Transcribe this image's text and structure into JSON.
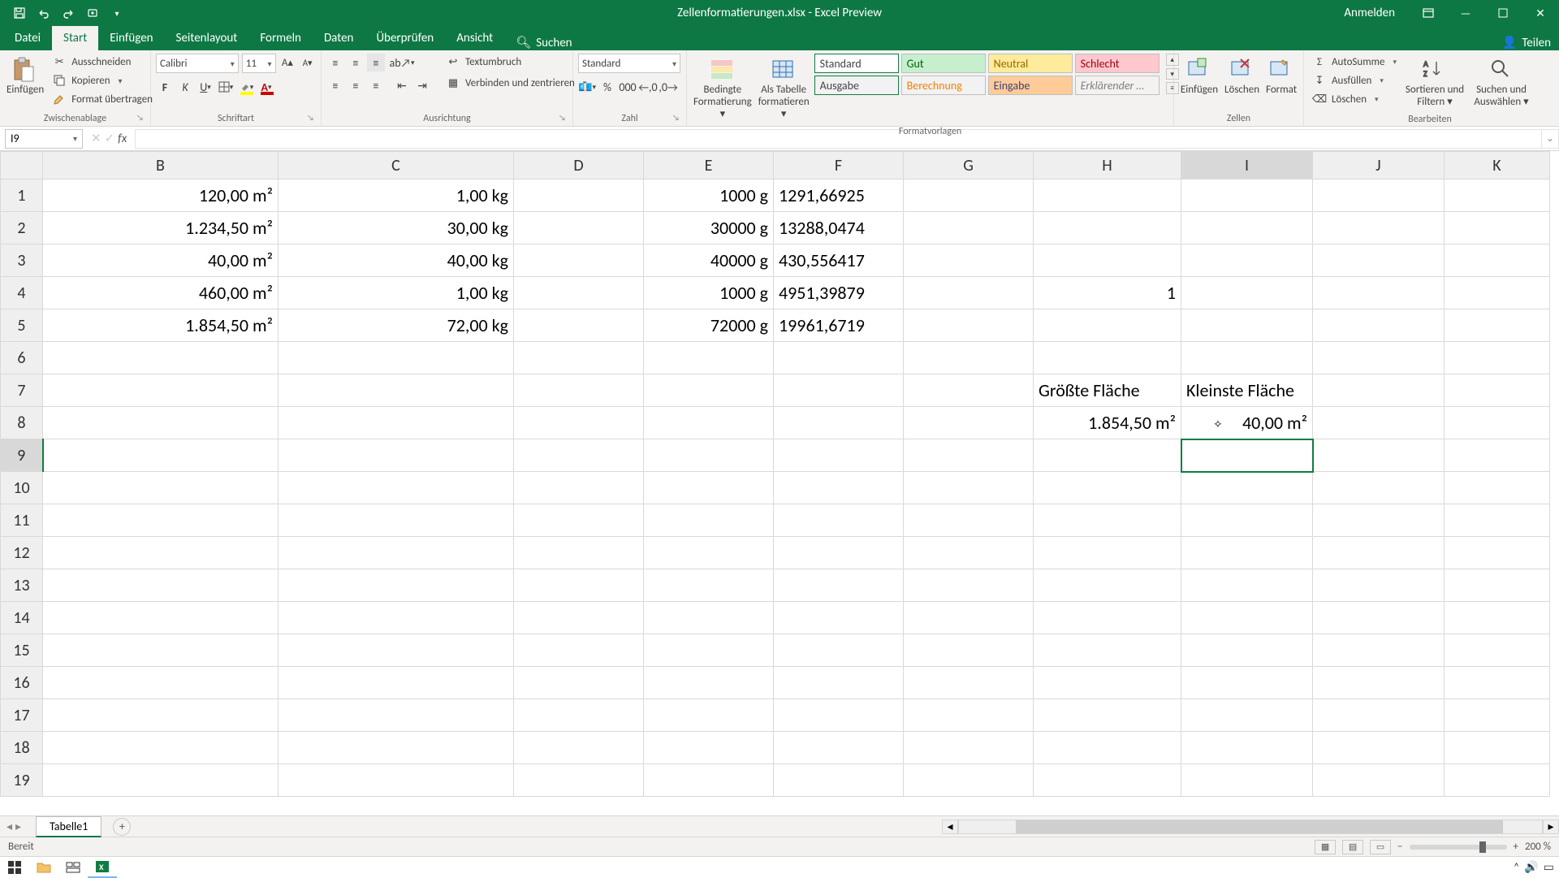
{
  "title_suffix": " - Excel Preview",
  "title_file": "Zellenformatierungen.xlsx",
  "signin": "Anmelden",
  "share": "Teilen",
  "tabs": {
    "file": "Datei",
    "home": "Start",
    "insert": "Einfügen",
    "layout": "Seitenlayout",
    "formulas": "Formeln",
    "data": "Daten",
    "review": "Überprüfen",
    "view": "Ansicht",
    "search": "Suchen"
  },
  "clipboard": {
    "paste": "Einfügen",
    "cut": "Ausschneiden",
    "copy": "Kopieren",
    "format_painter": "Format übertragen",
    "group": "Zwischenablage"
  },
  "font": {
    "name": "Calibri",
    "size": "11",
    "group": "Schriftart"
  },
  "alignment": {
    "wrap": "Textumbruch",
    "merge": "Verbinden und zentrieren",
    "group": "Ausrichtung"
  },
  "number": {
    "format": "Standard",
    "group": "Zahl"
  },
  "styles": {
    "cond": "Bedingte",
    "cond2": "Formatierung ▾",
    "table": "Als Tabelle",
    "table2": "formatieren ▾",
    "s1": "Standard",
    "s2": "Gut",
    "s3": "Neutral",
    "s4": "Schlecht",
    "s5": "Ausgabe",
    "s6": "Berechnung",
    "s7": "Eingabe",
    "s8": "Erklärender …",
    "group": "Formatvorlagen"
  },
  "cells": {
    "insert": "Einfügen",
    "delete": "Löschen",
    "format": "Format",
    "group": "Zellen"
  },
  "editing": {
    "sum": "AutoSumme",
    "fill": "Ausfüllen",
    "clear": "Löschen",
    "sort": "Sortieren und",
    "sort2": "Filtern ▾",
    "find": "Suchen und",
    "find2": "Auswählen ▾",
    "group": "Bearbeiten"
  },
  "namebox": "I9",
  "columns": [
    "B",
    "C",
    "D",
    "E",
    "F",
    "G",
    "H",
    "I",
    "J",
    "K"
  ],
  "rows": [
    "1",
    "2",
    "3",
    "4",
    "5",
    "6",
    "7",
    "8",
    "9",
    "10",
    "11",
    "12",
    "13",
    "14",
    "15",
    "16",
    "17",
    "18",
    "19"
  ],
  "cells_data": {
    "B1": "120,00 m²",
    "C1": "1,00 kg",
    "E1": "1000  g",
    "F1": "1291,66925",
    "B2": "1.234,50 m²",
    "C2": "30,00 kg",
    "E2": "30000  g",
    "F2": "13288,0474",
    "B3": "40,00 m²",
    "C3": "40,00 kg",
    "E3": "40000  g",
    "F3": "430,556417",
    "B4": "460,00 m²",
    "C4": "1,00 kg",
    "E4": "1000  g",
    "F4": "4951,39879",
    "H4": "1",
    "B5": "1.854,50 m²",
    "C5": "72,00 kg",
    "E5": "72000  g",
    "F5": "19961,6719",
    "H7": "Größte Fläche",
    "I7": "Kleinste Fläche",
    "H8": "1.854,50 m²",
    "I8": "40,00 m²"
  },
  "sel_col": "I",
  "sel_row": "9",
  "cursor_indicator": "✧",
  "sheet_tab": "Tabelle1",
  "status": "Bereit",
  "zoom": "200 %",
  "colwidths": {
    "B": 290,
    "C": 290,
    "D": 160,
    "E": 160,
    "F": 160,
    "G": 160,
    "H": 182,
    "I": 162,
    "J": 162,
    "K": 130
  }
}
